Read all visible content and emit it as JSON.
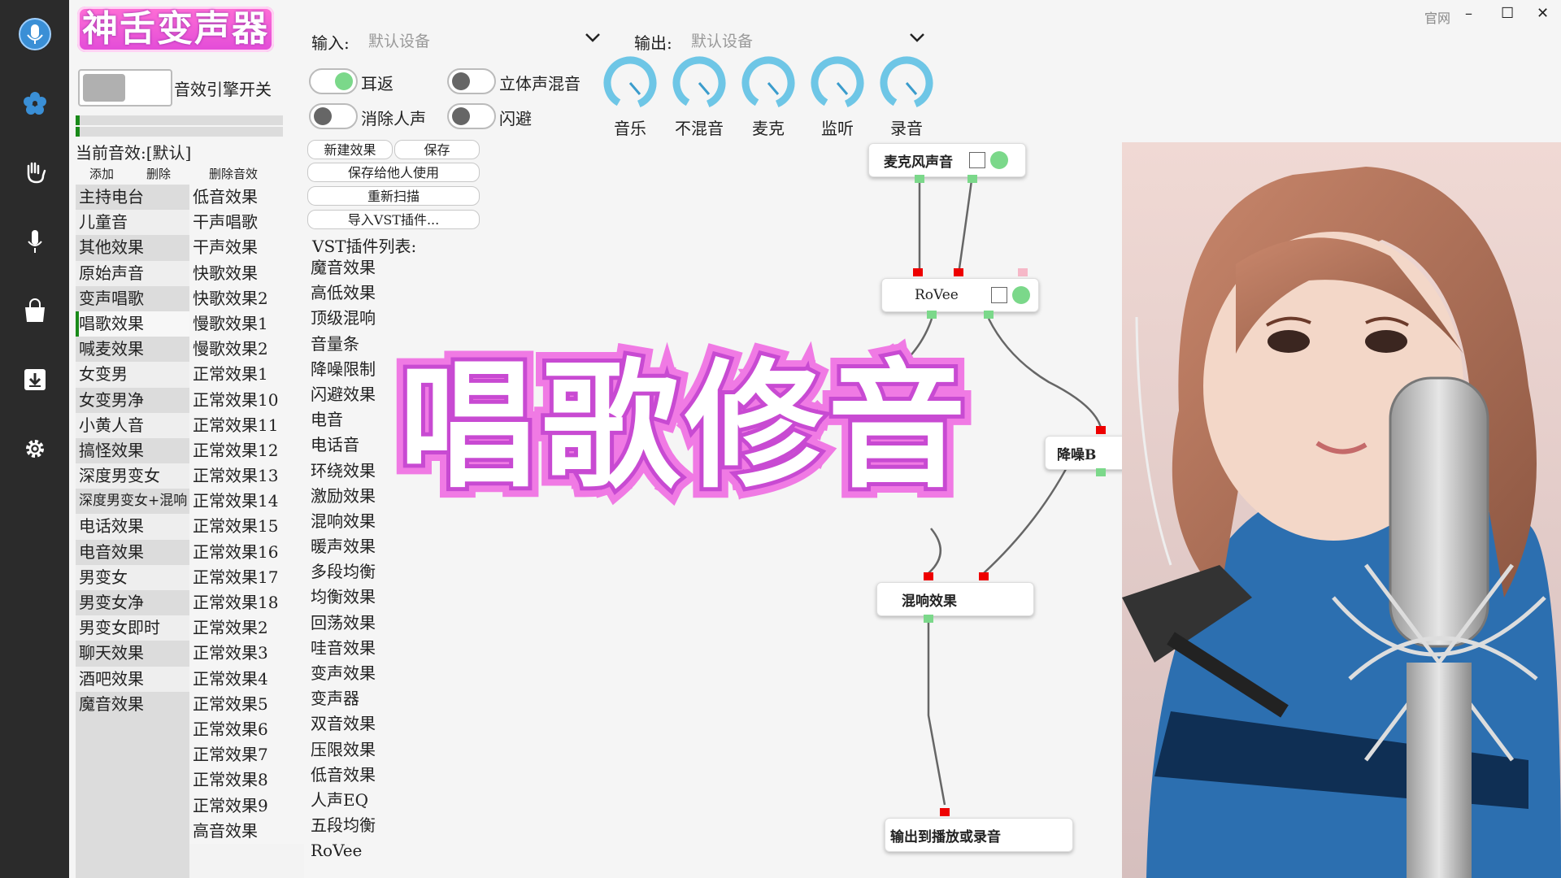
{
  "app": {
    "logo_text": "神舌变声器",
    "window_official": "官网",
    "minimize": "–",
    "maximize": "☐",
    "close": "✕"
  },
  "sidebar": {
    "icons": [
      "microphone-logo-icon",
      "flower-icon",
      "hand-icon",
      "mic-icon",
      "bag-icon",
      "download-icon",
      "gear-icon"
    ]
  },
  "engine": {
    "switch_label": "音效引擎开关"
  },
  "current_effect": "当前音效:[默认]",
  "list_actions": {
    "add": "添加",
    "delete": "删除",
    "delete_effect": "删除音效"
  },
  "effects_left": [
    "主持电台",
    "儿童音",
    "其他效果",
    "原始声音",
    "变声唱歌",
    "唱歌效果",
    "喊麦效果",
    "女变男",
    "女变男净",
    "小黄人音",
    "搞怪效果",
    "深度男变女",
    "深度男变女+混响",
    "电话效果",
    "电音效果",
    "男变女",
    "男变女净",
    "男变女即时",
    "聊天效果",
    "酒吧效果",
    "魔音效果"
  ],
  "effects_right": [
    "低音效果",
    "干声唱歌",
    "干声效果",
    "快歌效果",
    "快歌效果2",
    "慢歌效果1",
    "慢歌效果2",
    "正常效果1",
    "正常效果10",
    "正常效果11",
    "正常效果12",
    "正常效果13",
    "正常效果14",
    "正常效果15",
    "正常效果16",
    "正常效果17",
    "正常效果18",
    "正常效果2",
    "正常效果3",
    "正常效果4",
    "正常效果5",
    "正常效果6",
    "正常效果7",
    "正常效果8",
    "正常效果9",
    "高音效果"
  ],
  "selected_left": "唱歌效果",
  "io": {
    "input_label": "输入:",
    "input_value": "默认设备",
    "output_label": "输出:",
    "output_value": "默认设备"
  },
  "toggles": {
    "ear_return": "耳返",
    "stereo_mix": "立体声混音",
    "remove_vocal": "消除人声",
    "ducking": "闪避"
  },
  "knobs": [
    "音乐",
    "不混音",
    "麦克",
    "监听",
    "录音"
  ],
  "vst_buttons": {
    "new_effect": "新建效果",
    "save": "保存",
    "save_for_others": "保存给他人使用",
    "rescan": "重新扫描",
    "import_vst": "导入VST插件..."
  },
  "vst_list_title": "VST插件列表:",
  "vst_list": [
    "魔音效果",
    "高低效果",
    "顶级混响",
    "音量条",
    "降噪限制",
    "闪避效果",
    "电音",
    "电话音",
    "环绕效果",
    "激励效果",
    "混响效果",
    "暖声效果",
    "多段均衡",
    "均衡效果",
    "回荡效果",
    "哇音效果",
    "变声效果",
    "变声器",
    "双音效果",
    "压限效果",
    "低音效果",
    "人声EQ",
    "五段均衡",
    "RoVee"
  ],
  "graph_nodes": {
    "mic": "麦克风声音",
    "rovee": "RoVee",
    "denoise": "降噪B",
    "reverb": "混响效果",
    "output": "输出到播放或录音"
  },
  "banner_text": "唱歌修音"
}
